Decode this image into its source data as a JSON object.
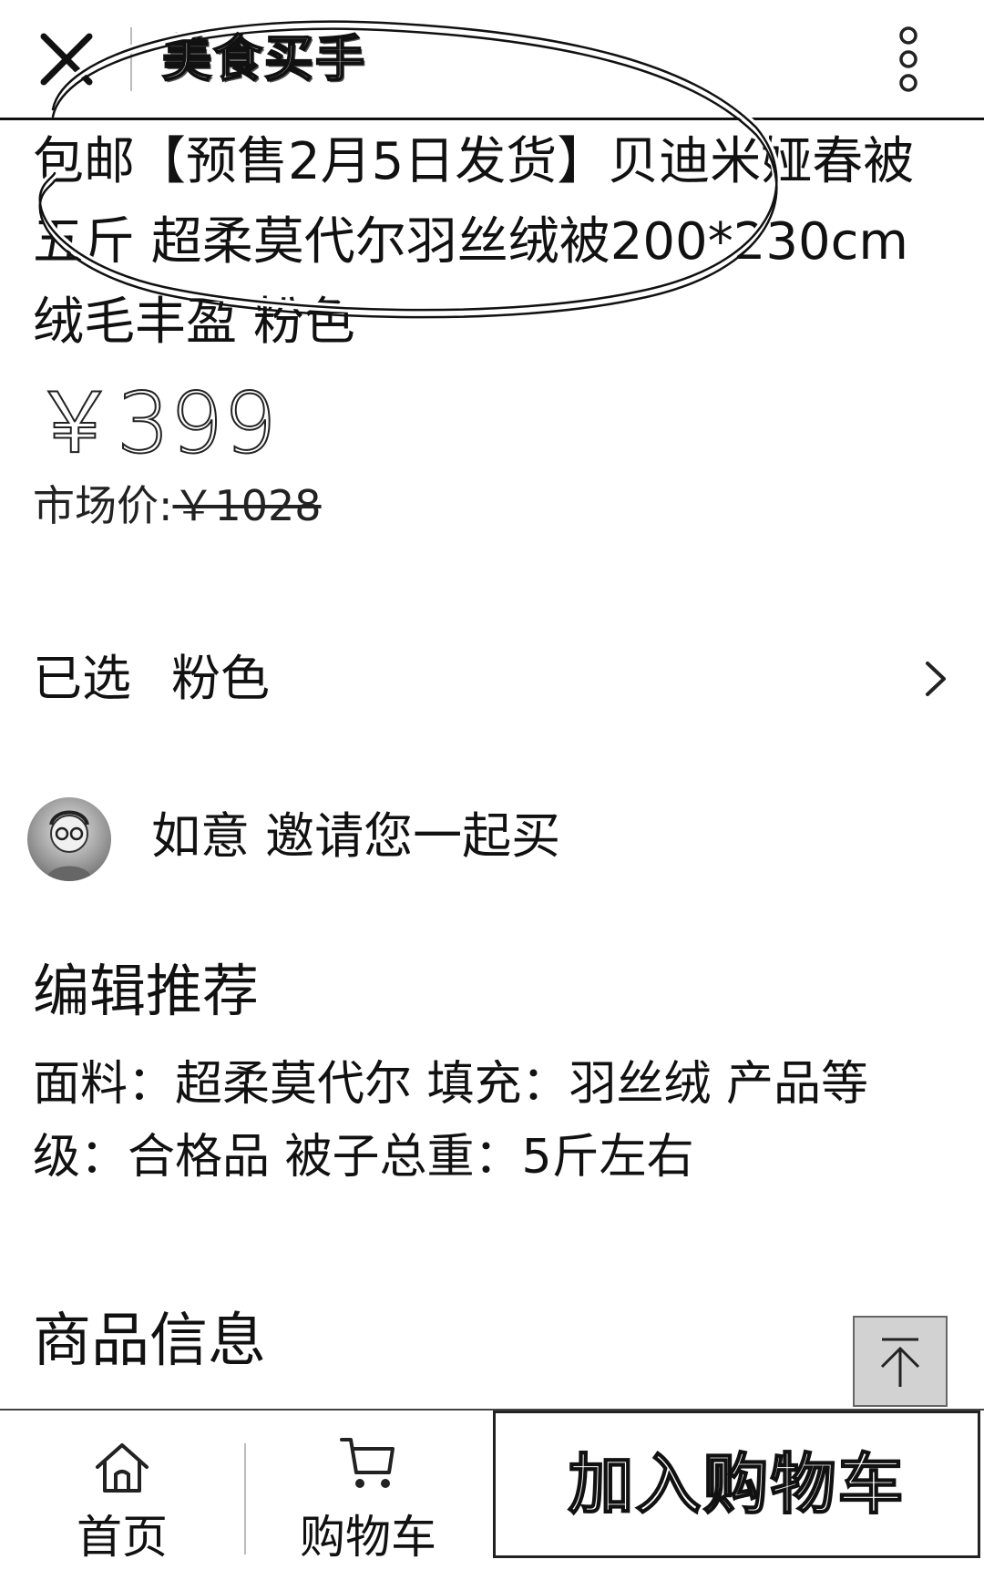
{
  "header": {
    "title": "美食买手",
    "close_icon": "close-icon",
    "more_icon": "more-vertical-icon"
  },
  "product": {
    "title": "包邮【预售2月5日发货】贝迪米娅春被五斤 超柔莫代尔羽丝绒被200*230cm绒毛丰盈 粉色",
    "price": "￥399",
    "market_price_label": "市场价:",
    "market_price_value": "￥1028"
  },
  "selected": {
    "label": "已选",
    "value": "粉色"
  },
  "invite": {
    "text": "如意 邀请您一起买"
  },
  "recommendation": {
    "heading": "编辑推荐",
    "body": "面料：超柔莫代尔 填充：羽丝绒 产品等级：合格品 被子总重：5斤左右"
  },
  "info": {
    "heading": "商品信息"
  },
  "bottom_bar": {
    "home_label": "首页",
    "cart_label": "购物车",
    "add_to_cart_label": "加入购物车"
  },
  "colors": {
    "text": "#111111",
    "background": "#ffffff",
    "back_to_top_bg": "#d2d2d2"
  }
}
